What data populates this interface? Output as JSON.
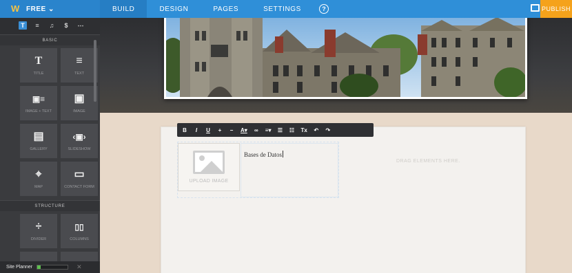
{
  "topbar": {
    "brand_label": "FREE ⌄",
    "nav": [
      {
        "label": "BUILD",
        "active": true
      },
      {
        "label": "DESIGN",
        "active": false
      },
      {
        "label": "PAGES",
        "active": false
      },
      {
        "label": "SETTINGS",
        "active": false
      }
    ],
    "help_label": "?",
    "publish_label": "PUBLISH",
    "brand_color": "#2f8fd8",
    "publish_color": "#f5a21b"
  },
  "sidebar": {
    "tool_tabs": [
      {
        "glyph": "T",
        "icon": "text-tool-icon",
        "active": true
      },
      {
        "glyph": "≡",
        "icon": "layout-tool-icon",
        "active": false
      },
      {
        "glyph": "♫",
        "icon": "media-tool-icon",
        "active": false
      },
      {
        "glyph": "$",
        "icon": "commerce-tool-icon",
        "active": false
      },
      {
        "glyph": "⋯",
        "icon": "more-tool-icon",
        "active": false
      }
    ],
    "sections": {
      "basic": "BASIC",
      "structure": "STRUCTURE"
    },
    "basic_tiles": [
      {
        "glyph": "T",
        "label": "TITLE"
      },
      {
        "glyph": "≡",
        "label": "TEXT"
      },
      {
        "glyph": "▣≡",
        "label": "IMAGE + TEXT"
      },
      {
        "glyph": "▣",
        "label": "IMAGE"
      },
      {
        "glyph": "▤",
        "label": "GALLERY"
      },
      {
        "glyph": "‹▣›",
        "label": "SLIDESHOW"
      },
      {
        "glyph": "⌖",
        "label": "MAP"
      },
      {
        "glyph": "▭",
        "label": "CONTACT FORM"
      }
    ],
    "structure_tiles": [
      {
        "glyph": "÷",
        "label": "DIVIDER"
      },
      {
        "glyph": "▯▯",
        "label": "COLUMNS"
      }
    ],
    "site_planner_label": "Site Planner",
    "site_planner_progress": 0.1,
    "site_planner_close": "✕"
  },
  "editor": {
    "toolbar_buttons": [
      "B",
      "I",
      "U",
      "+",
      "−",
      "A▾",
      "∞",
      "≡▾",
      "☰",
      "☷",
      "Tx",
      "↶",
      "↷"
    ],
    "upload_label": "UPLOAD IMAGE",
    "text_value": "Bases de Datos",
    "drag_hint": "DRAG ELEMENTS HERE."
  }
}
